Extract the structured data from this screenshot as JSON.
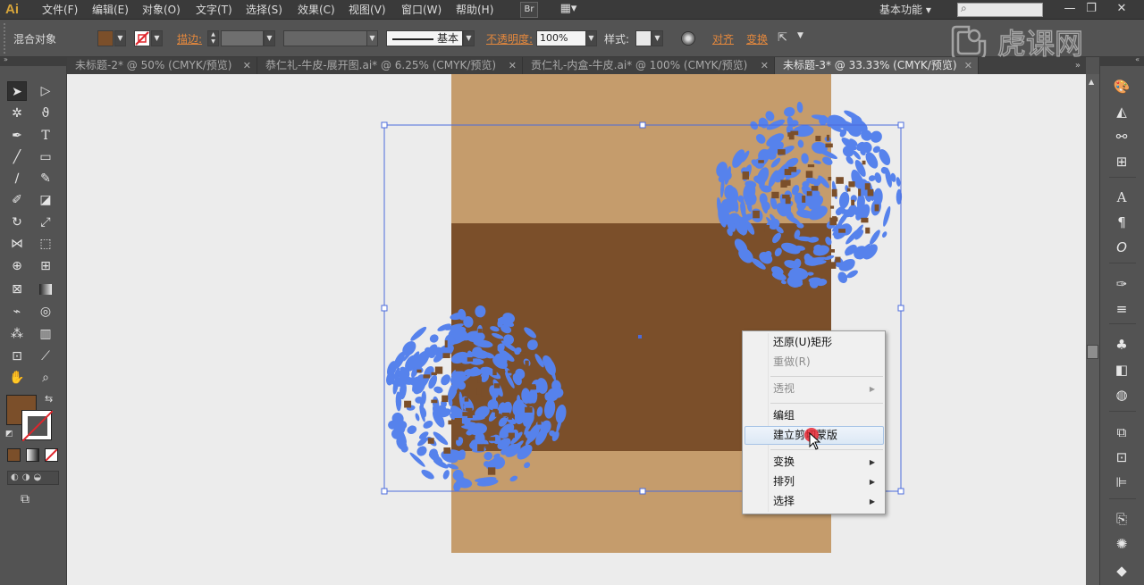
{
  "app": {
    "logo": "Ai",
    "workspace": "基本功能"
  },
  "menubar": {
    "items": [
      "文件(F)",
      "编辑(E)",
      "对象(O)",
      "文字(T)",
      "选择(S)",
      "效果(C)",
      "视图(V)",
      "窗口(W)",
      "帮助(H)"
    ],
    "bridge_label": "Br",
    "win_min": "—",
    "win_max": "❐",
    "win_close": "✕"
  },
  "control": {
    "selection_label": "混合对象",
    "stroke_label": "描边:",
    "stroke_style": "基本",
    "opacity_label": "不透明度:",
    "opacity_value": "100%",
    "style_label": "样式:",
    "align_label": "对齐",
    "transform_label": "变换",
    "fill_color": "#7b4f2a"
  },
  "tabs": [
    {
      "label": "未标题-2* @ 50% (CMYK/预览)",
      "active": false
    },
    {
      "label": "恭仁礼-牛皮-展开图.ai* @ 6.25% (CMYK/预览)",
      "active": false
    },
    {
      "label": "贡仁礼-内盒-牛皮.ai* @ 100% (CMYK/预览)",
      "active": false
    },
    {
      "label": "未标题-3* @ 33.33% (CMYK/预览)",
      "active": true
    }
  ],
  "tab_close": "✕",
  "colors": {
    "kraft_light": "#c59c6c",
    "kraft_dark": "#7b4f2a",
    "pattern_blue": "#5682ec",
    "selection_blue": "#4b6bdc",
    "artboard_bg": "#ececec"
  },
  "context_menu": {
    "items": [
      {
        "label": "还原(U)矩形",
        "disabled": false
      },
      {
        "label": "重做(R)",
        "disabled": true
      },
      {
        "label": "透视",
        "disabled": true,
        "submenu": true
      },
      {
        "label": "编组",
        "disabled": false
      },
      {
        "label": "建立剪切蒙版",
        "disabled": false,
        "hover": true
      },
      {
        "label": "变换",
        "disabled": false,
        "submenu": true
      },
      {
        "label": "排列",
        "disabled": false,
        "submenu": true
      },
      {
        "label": "选择",
        "disabled": false,
        "submenu": true
      }
    ],
    "submenu_arrow": "▶"
  },
  "watermark": "虎课网"
}
